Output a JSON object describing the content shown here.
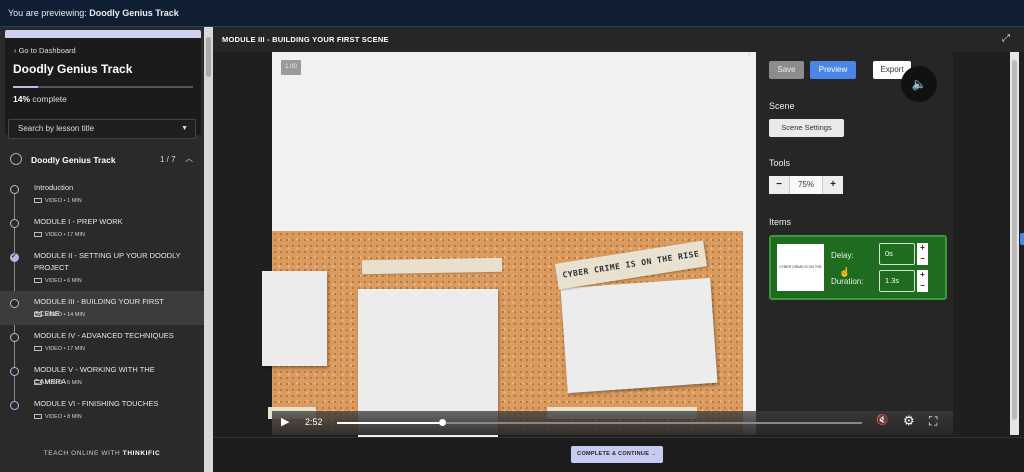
{
  "topbar": {
    "prefix": "You are previewing:",
    "track": "Doodly Genius Track"
  },
  "sidebar": {
    "dashboard_link": "Go to Dashboard",
    "track_title": "Doodly Genius Track",
    "progress_percent": 14,
    "progress_value": "14%",
    "progress_suffix": "complete",
    "search_placeholder": "Search by lesson title",
    "chapter": {
      "name": "Doodly Genius Track",
      "count": "1 / 7"
    },
    "lessons": [
      {
        "title": "Introduction",
        "meta": "VIDEO • 1 MIN",
        "status": "open"
      },
      {
        "title": "MODULE I - PREP WORK",
        "meta": "VIDEO • 17 MIN",
        "status": "open"
      },
      {
        "title": "MODULE II - SETTING UP YOUR DOODLY PROJECT",
        "meta": "VIDEO • 6 MIN",
        "status": "done"
      },
      {
        "title": "MODULE III - BUILDING YOUR FIRST SCENE",
        "meta": "VIDEO • 14 MIN",
        "status": "active"
      },
      {
        "title": "MODULE IV - ADVANCED TECHNIQUES",
        "meta": "VIDEO • 17 MIN",
        "status": "open"
      },
      {
        "title": "MODULE V - WORKING WITH THE CAMERA",
        "meta": "VIDEO • 6 MIN",
        "status": "open"
      },
      {
        "title": "MODULE VI - FINISHING TOUCHES",
        "meta": "VIDEO • 8 MIN",
        "status": "open"
      }
    ],
    "footer_prefix": "TEACH ONLINE WITH",
    "footer_brand": "THINKIFIC"
  },
  "main": {
    "title": "MODULE III - BUILDING YOUR FIRST SCENE",
    "complete_button": "COMPLETE & CONTINUE →"
  },
  "video": {
    "speed": "1.00",
    "time": "2:52",
    "progress_fraction": 0.2,
    "banner_text": "CYBER CRIME IS ON THE RISE"
  },
  "editor": {
    "save": "Save",
    "preview": "Preview",
    "export": "Export",
    "scene_label": "Scene",
    "scene_settings": "Scene Settings",
    "tools_label": "Tools",
    "zoom_minus": "−",
    "zoom_value": "75%",
    "zoom_plus": "+",
    "items_label": "Items",
    "item": {
      "thumb_text": "CYBER CRIME IS ON THE RISE",
      "delay_label": "Delay:",
      "delay_value": "0s",
      "duration_label": "Duration:",
      "duration_value": "1.3s"
    }
  },
  "colors": {
    "accent": "#4a86e8",
    "progress": "#bdbef0",
    "item_green": "#1f6b1f",
    "topbar": "#0f1e33"
  }
}
